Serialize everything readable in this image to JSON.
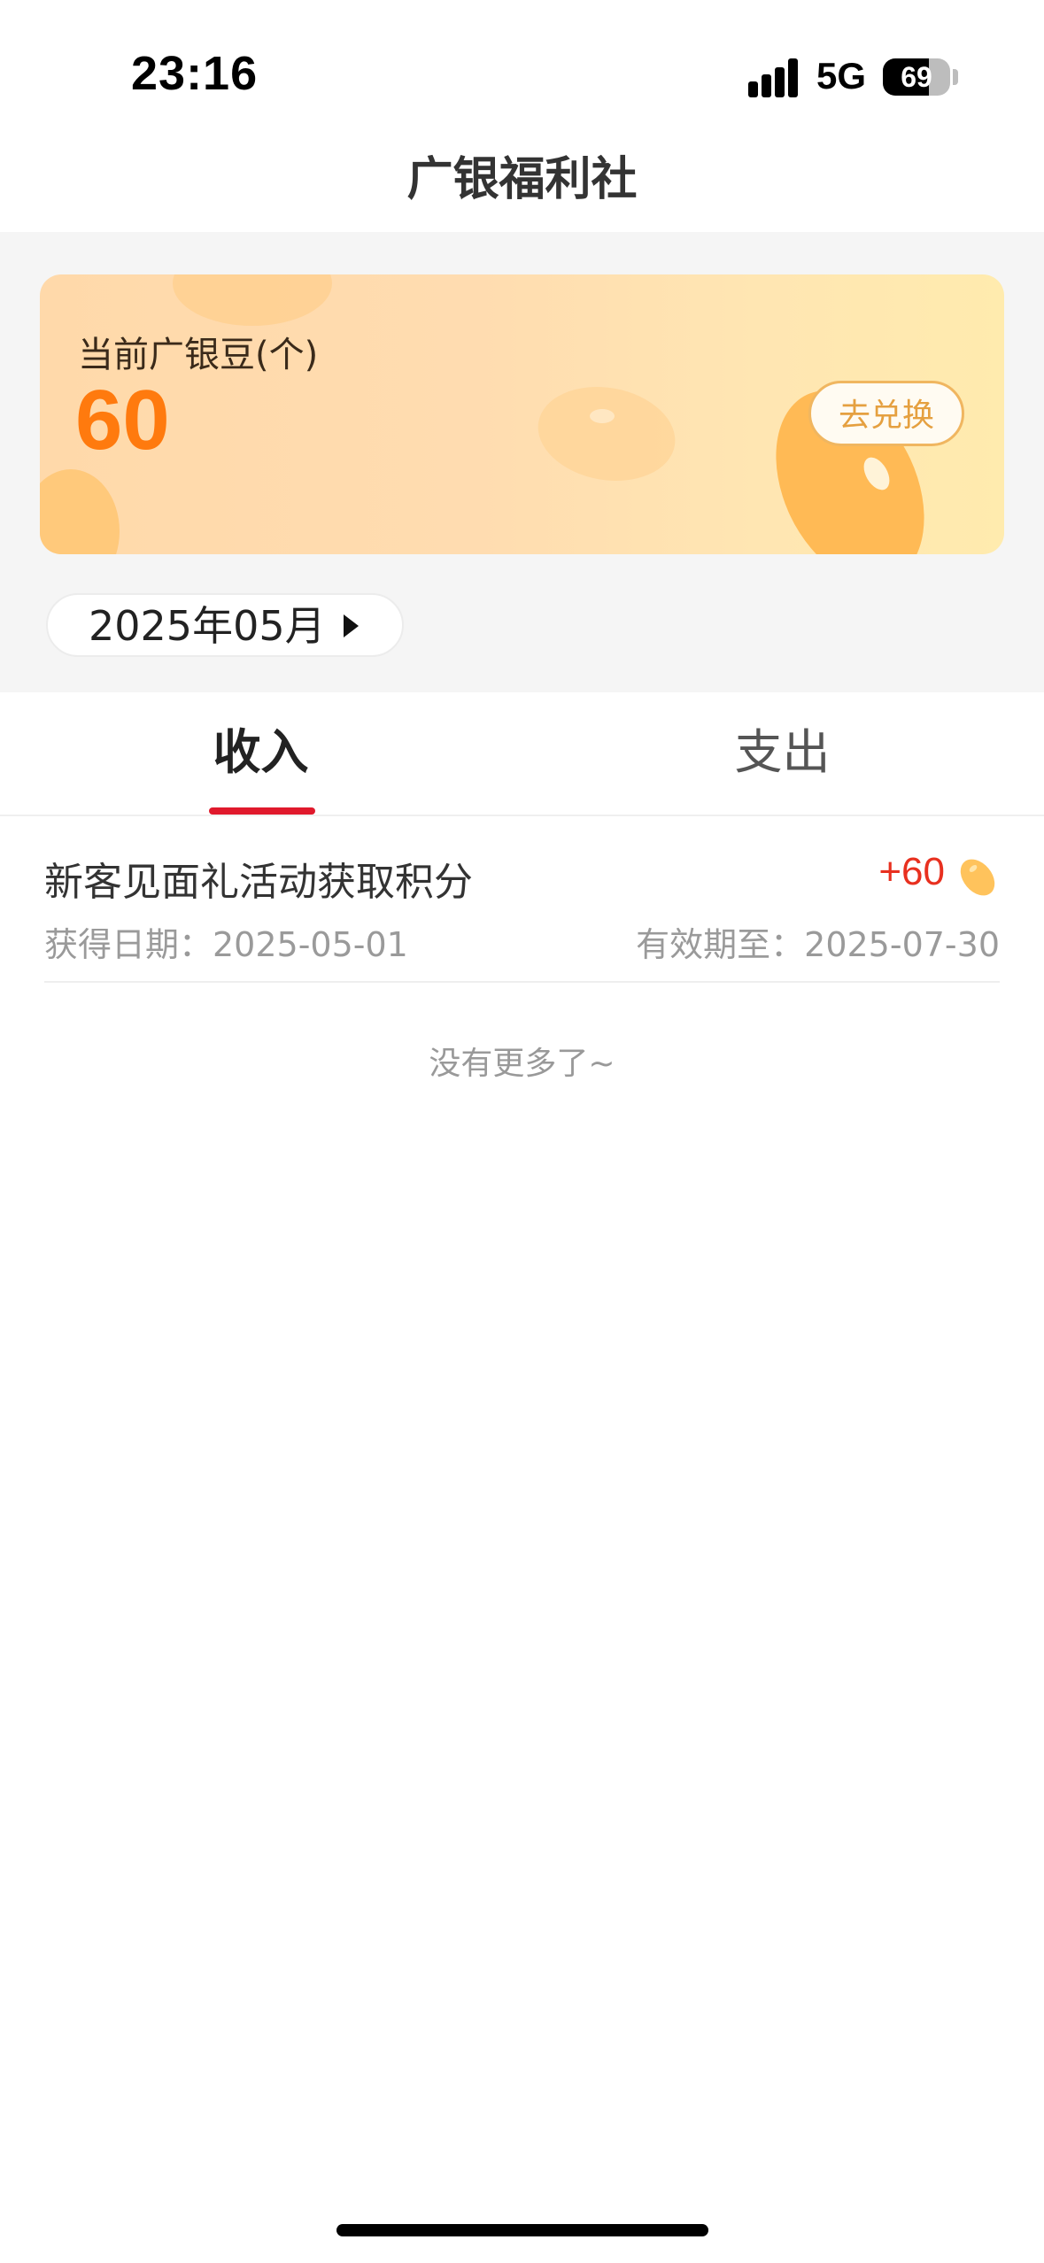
{
  "status_bar": {
    "time": "23:16",
    "network": "5G",
    "battery": "69",
    "battery_level": 0.69
  },
  "nav": {
    "title": "广银福利社"
  },
  "bean_card": {
    "label": "当前广银豆(个)",
    "value": "60",
    "redeem_label": "去兑换",
    "colors": {
      "value": "#ff7a0e",
      "button_text": "#e5a040"
    }
  },
  "month_picker": {
    "label": "2025年05月"
  },
  "tabs": [
    {
      "label": "收入",
      "active": true
    },
    {
      "label": "支出",
      "active": false
    }
  ],
  "records": [
    {
      "title": "新客见面礼活动获取积分",
      "amount": "+60",
      "date": "获得日期：2025-05-01",
      "expiry": "有效期至：2025-07-30",
      "icon": "bean-icon"
    }
  ],
  "footer": {
    "no_more": "没有更多了~"
  },
  "colors": {
    "accent_red": "#e0192c",
    "amount_red": "#e8301f"
  }
}
